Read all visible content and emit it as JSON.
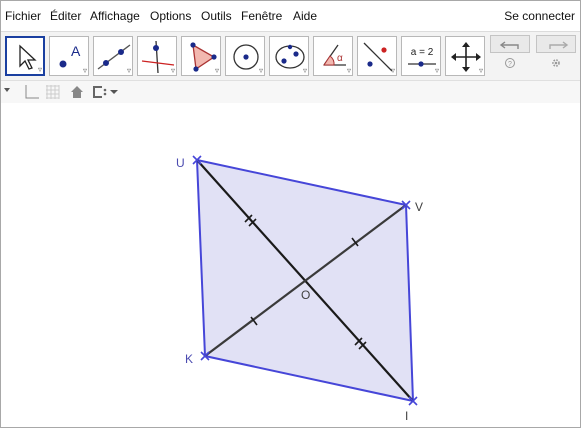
{
  "menu": {
    "items": [
      "Fichier",
      "Éditer",
      "Affichage",
      "Options",
      "Outils",
      "Fenêtre",
      "Aide"
    ],
    "login": "Se connecter"
  },
  "toolbar": {
    "tools": [
      {
        "name": "move",
        "icon": "arrow-pointer-icon",
        "selected": true
      },
      {
        "name": "point",
        "icon": "point-icon",
        "label": "A"
      },
      {
        "name": "line",
        "icon": "line-icon"
      },
      {
        "name": "perpendicular",
        "icon": "perpendicular-line-icon"
      },
      {
        "name": "polygon",
        "icon": "polygon-icon"
      },
      {
        "name": "circle",
        "icon": "circle-center-point-icon"
      },
      {
        "name": "conic",
        "icon": "conic-icon"
      },
      {
        "name": "angle",
        "icon": "angle-icon",
        "label": "α"
      },
      {
        "name": "reflect",
        "icon": "reflect-icon"
      },
      {
        "name": "slider",
        "icon": "slider-icon",
        "label": "a = 2"
      },
      {
        "name": "move-view",
        "icon": "move-graphics-icon"
      }
    ],
    "undo_icon": "undo-icon",
    "redo_icon": "redo-icon",
    "help_icon": "help-icon",
    "settings_icon": "settings-icon"
  },
  "stylebar": {
    "icons": [
      "axes-icon",
      "grid-icon",
      "home-icon",
      "point-capture-icon"
    ]
  },
  "graphics": {
    "colors": {
      "polygon_fill": "#e1e1f5",
      "polygon_stroke": "#4646d8",
      "diagonal": "#1a1a1a",
      "point": "#4646d8"
    },
    "points": {
      "U": {
        "label": "U"
      },
      "V": {
        "label": "V"
      },
      "K": {
        "label": "K"
      },
      "I": {
        "label": "I"
      },
      "O": {
        "label": "O"
      }
    }
  }
}
